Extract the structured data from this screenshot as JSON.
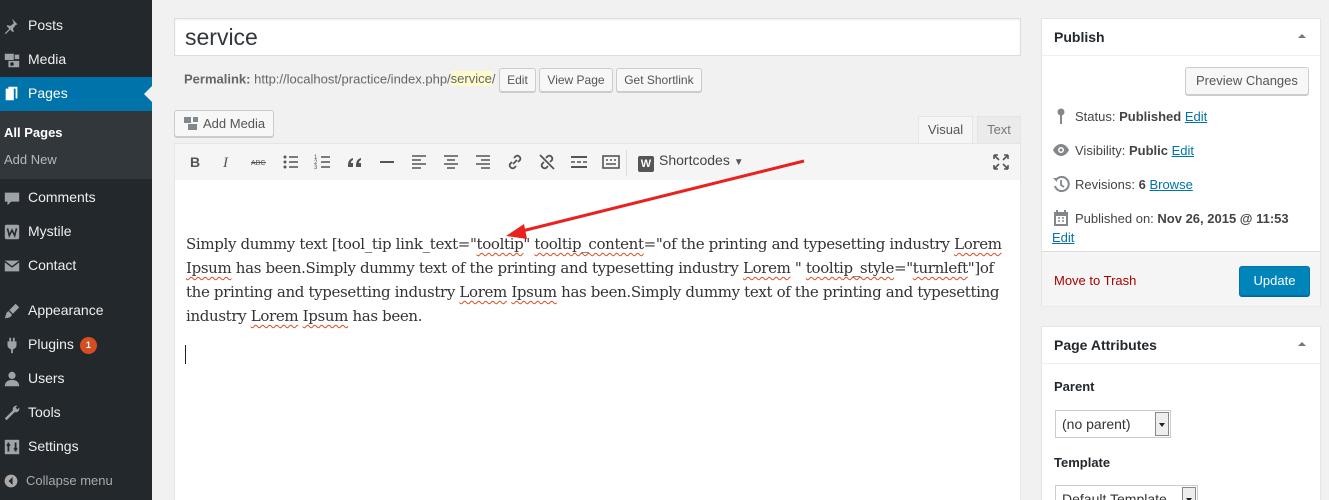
{
  "sidebar": {
    "items": [
      {
        "label": "Posts",
        "icon": "pushpin-icon"
      },
      {
        "label": "Media",
        "icon": "media-icon"
      },
      {
        "label": "Pages",
        "icon": "pages-icon",
        "current": true
      },
      {
        "label": "Comments",
        "icon": "comment-icon"
      },
      {
        "label": "Mystile",
        "icon": "woo-theme-icon"
      },
      {
        "label": "Contact",
        "icon": "envelope-icon"
      },
      {
        "label": "Appearance",
        "icon": "paintbrush-icon"
      },
      {
        "label": "Plugins",
        "icon": "plug-icon",
        "badge": "1"
      },
      {
        "label": "Users",
        "icon": "user-icon"
      },
      {
        "label": "Tools",
        "icon": "wrench-icon"
      },
      {
        "label": "Settings",
        "icon": "settings-icon"
      }
    ],
    "submenu": [
      "All Pages",
      "Add New"
    ],
    "collapse_label": "Collapse menu",
    "colors": {
      "background": "#23282d",
      "current": "#0073aa",
      "badge": "#d54e21"
    }
  },
  "editor": {
    "title": "service",
    "permalink": {
      "label": "Permalink:",
      "base": "http://localhost/practice/index.php/",
      "slug": "service",
      "trailing": "/",
      "edit_button": "Edit",
      "view_button": "View Page",
      "shortlink_button": "Get Shortlink"
    },
    "add_media_label": "Add Media",
    "tabs": {
      "visual": "Visual",
      "text": "Text"
    },
    "toolbar": {
      "buttons": [
        "bold",
        "italic",
        "strikethrough",
        "bulleted-list",
        "numbered-list",
        "blockquote",
        "horizontal-line",
        "align-left",
        "align-center",
        "align-right",
        "insert-link",
        "remove-link",
        "read-more",
        "toolbar-toggle"
      ],
      "shortcodes_label": "Shortcodes",
      "fullscreen": "fullscreen"
    },
    "content": {
      "t1": "Simply dummy text [tool_tip link_text=\"",
      "w1": "tooltip",
      "t2": "\" ",
      "w2": "tooltip_content",
      "t3": "=\"of the printing and typesetting industry ",
      "w3": "Lorem",
      "t4": " ",
      "w4": "Ipsum",
      "t5": " has been.Simply dummy text of the printing and typesetting industry ",
      "w5": "Lorem",
      "t6": " \" ",
      "w6": "tooltip_style",
      "t7": "=\"",
      "w7": "turnleft",
      "t8": "\"]of the printing and typesetting industry ",
      "w8": "Lorem",
      "t9": " ",
      "w9": "Ipsum",
      "t10": " has been.Simply dummy text of the printing and typesetting industry ",
      "w10": "Lorem",
      "t11": " ",
      "w11": "Ipsum",
      "t12": " has been."
    },
    "annotation_arrow_color": "#e8231f"
  },
  "publish": {
    "title": "Publish",
    "preview_label": "Preview Changes",
    "status_label": "Status:",
    "status_value": "Published",
    "visibility_label": "Visibility:",
    "visibility_value": "Public",
    "revisions_label": "Revisions:",
    "revisions_value": "6",
    "published_on_label": "Published on:",
    "published_on_value": "Nov 26, 2015 @ 11:53",
    "edit_link": "Edit",
    "browse_link": "Browse",
    "trash_label": "Move to Trash",
    "update_label": "Update",
    "colors": {
      "update": "#0085ba",
      "trash": "#aa0000",
      "link": "#0073aa"
    }
  },
  "page_attributes": {
    "title": "Page Attributes",
    "parent_label": "Parent",
    "parent_value": "(no parent)",
    "template_label": "Template",
    "template_value": "Default Template"
  }
}
